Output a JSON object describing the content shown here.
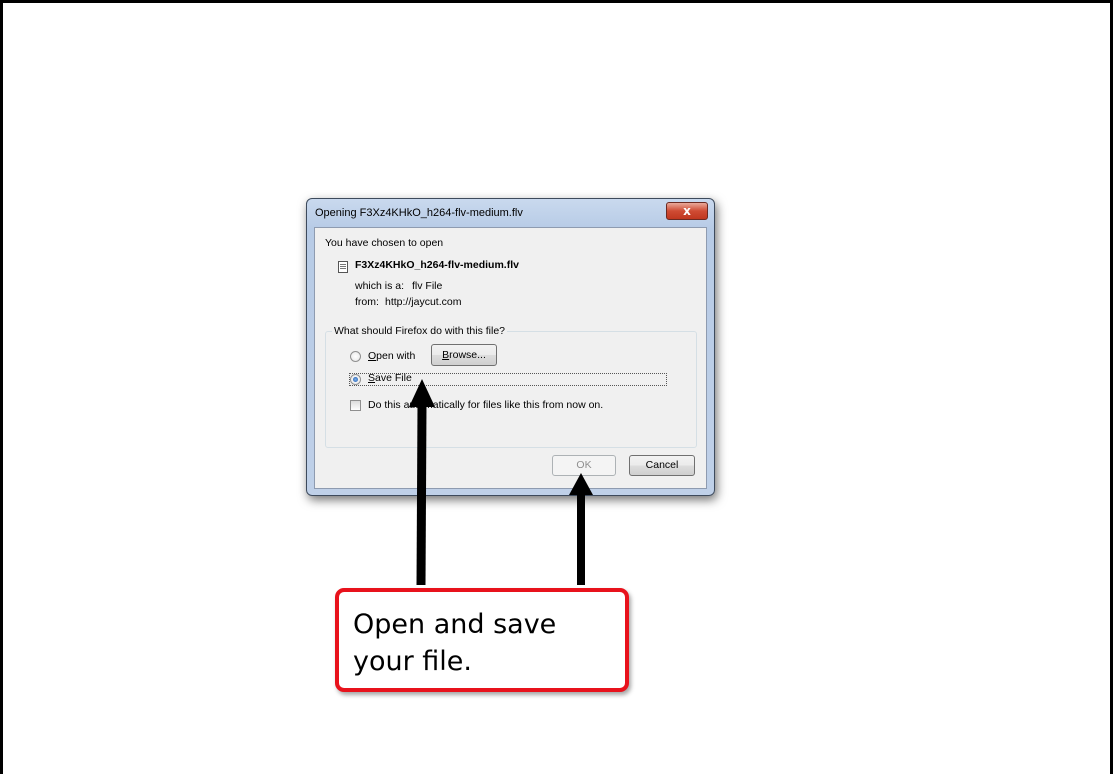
{
  "dialog": {
    "title": "Opening F3Xz4KHkO_h264-flv-medium.flv",
    "close_glyph": "x",
    "intro": "You have chosen to open",
    "file_icon": "document-icon",
    "filename": "F3Xz4KHkO_h264-flv-medium.flv",
    "which_is_label": "which is a:",
    "which_is_value": "flv File",
    "from_label": "from:",
    "from_value": "http://jaycut.com",
    "group_legend": "What should Firefox do with this file?",
    "open_with": {
      "label_prefix": "",
      "label_mnemonic": "O",
      "label_rest": "pen with",
      "selected": false
    },
    "browse_button": {
      "mnemonic": "B",
      "rest": "rowse..."
    },
    "save_file": {
      "label_mnemonic": "S",
      "label_rest": "ave File",
      "selected": true
    },
    "auto_checkbox": {
      "label": "Do this automatically for files like this from now on.",
      "checked": false
    },
    "ok_label": "OK",
    "cancel_label": "Cancel"
  },
  "callout": {
    "line1": "Open and save",
    "line2": "your file."
  },
  "colors": {
    "callout_border": "#e8121c",
    "arrow": "#000000"
  }
}
